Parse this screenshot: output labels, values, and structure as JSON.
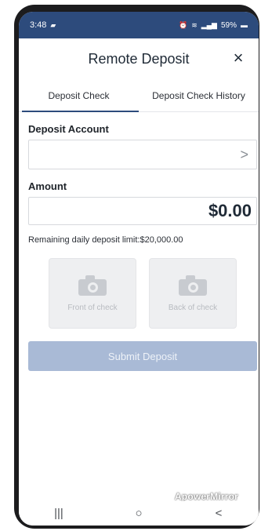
{
  "status_bar": {
    "time": "3:48",
    "notification_icon": "sim-card-icon",
    "battery": "59%"
  },
  "header": {
    "title": "Remote Deposit",
    "close_symbol": "×"
  },
  "tabs": [
    {
      "label": "Deposit Check",
      "active": true
    },
    {
      "label": "Deposit Check History",
      "active": false
    }
  ],
  "form": {
    "deposit_account_label": "Deposit Account",
    "deposit_account_value": "",
    "amount_label": "Amount",
    "amount_value": "$0.00",
    "limit_text": "Remaining daily deposit limit:$20,000.00"
  },
  "check_images": {
    "front_label": "Front of check",
    "back_label": "Back of check"
  },
  "submit": {
    "label": "Submit Deposit"
  },
  "watermark": "ApowerMirror",
  "nav": {
    "recent": "|||",
    "home": "○",
    "back": "<"
  },
  "colors": {
    "primary": "#2d4b7c",
    "submit_disabled": "#a9bad6"
  }
}
